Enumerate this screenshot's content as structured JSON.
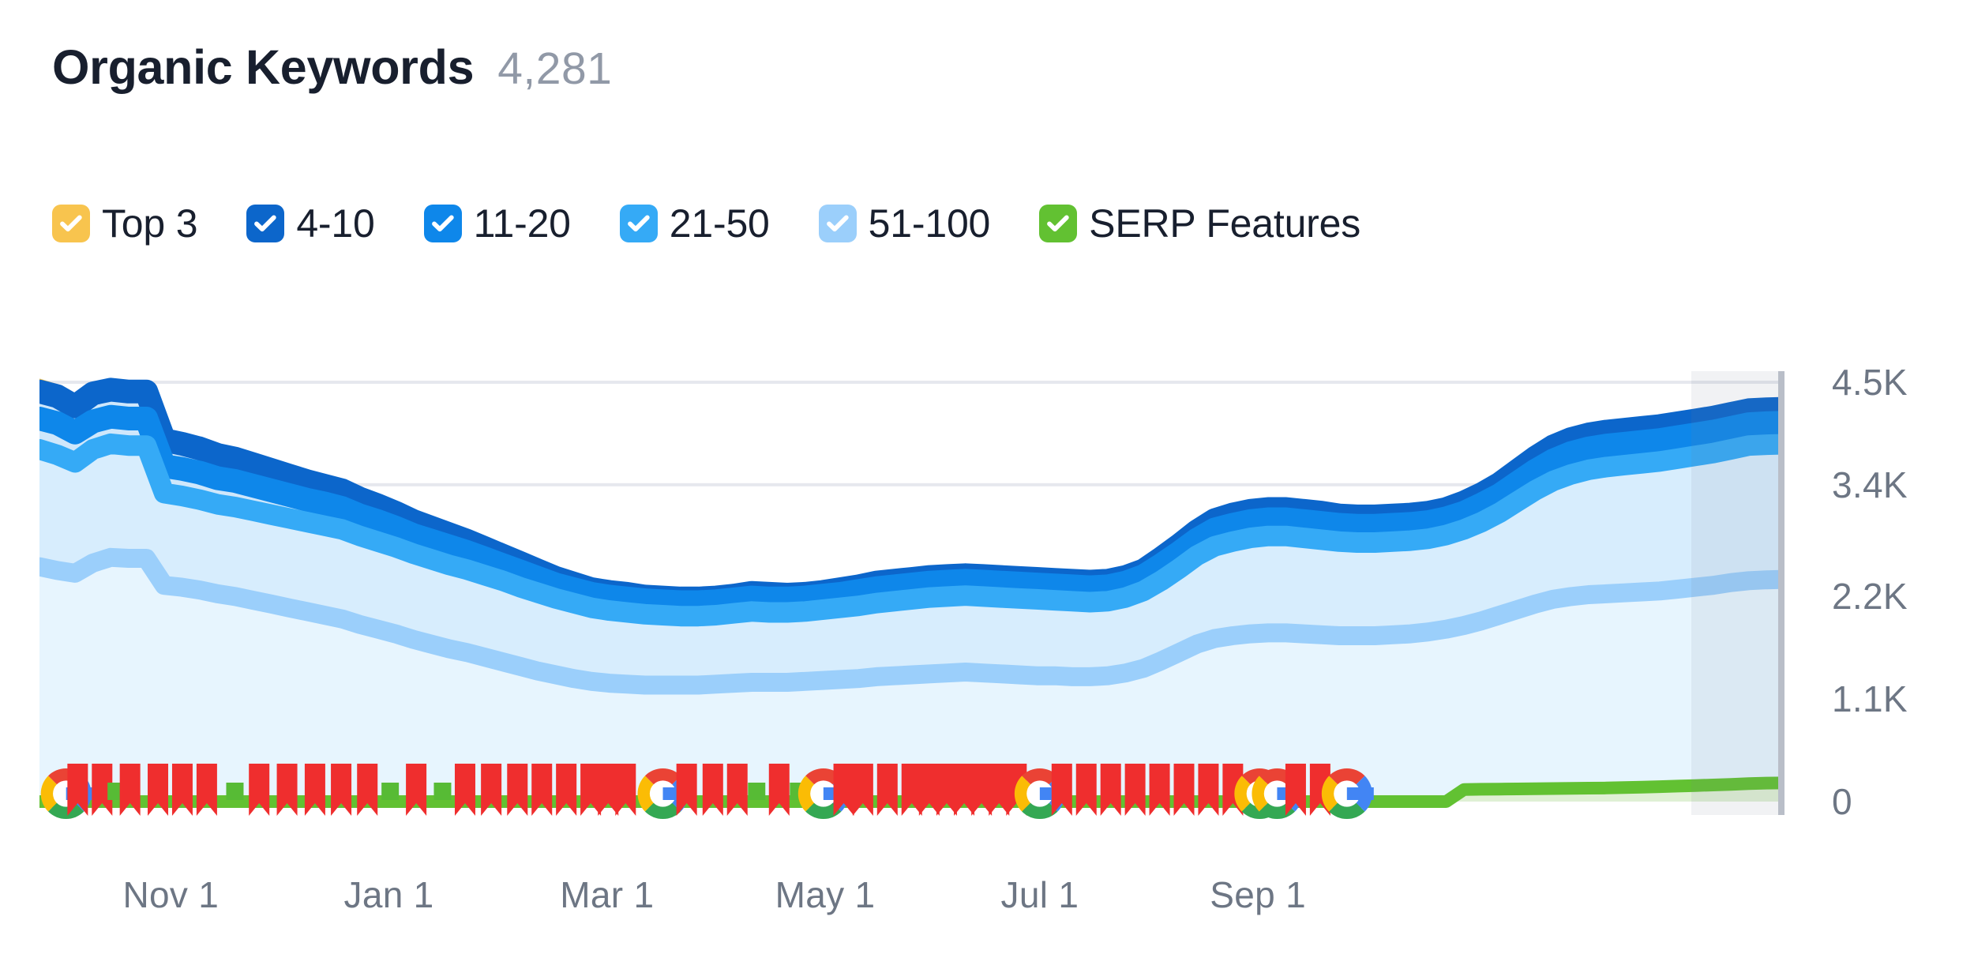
{
  "header": {
    "title": "Organic Keywords",
    "value": "4,281"
  },
  "legend": {
    "items": [
      {
        "label": "Top 3",
        "color": "#f8c44e",
        "checked": true,
        "icon": "check-icon"
      },
      {
        "label": "4-10",
        "color": "#0c66cb",
        "checked": true,
        "icon": "check-icon"
      },
      {
        "label": "11-20",
        "color": "#0e87ea",
        "checked": true,
        "icon": "check-icon"
      },
      {
        "label": "21-50",
        "color": "#35aaf6",
        "checked": true,
        "icon": "check-icon"
      },
      {
        "label": "51-100",
        "color": "#9bcffb",
        "checked": true,
        "icon": "check-icon"
      },
      {
        "label": "SERP Features",
        "color": "#62c132",
        "checked": true,
        "icon": "check-icon"
      }
    ]
  },
  "chart_data": {
    "type": "area",
    "title": "Organic Keywords",
    "xlabel": "",
    "ylabel": "",
    "stacked": true,
    "grid": true,
    "legend_position": "top",
    "ylim": [
      0,
      4500
    ],
    "yticks": [
      0,
      1100,
      2200,
      3400,
      4500
    ],
    "ytick_labels": [
      "0",
      "1.1K",
      "2.2K",
      "3.4K",
      "4.5K"
    ],
    "xticks": [
      "Nov 1",
      "Jan 1",
      "Mar 1",
      "May 1",
      "Jul 1",
      "Sep 1"
    ],
    "xtick_positions_pct": [
      3.0,
      15.5,
      28.0,
      40.5,
      52.8,
      65.3
    ],
    "x_start": "Oct 15",
    "x_end": "Sep 30",
    "colors": {
      "top3": "#f8c44e",
      "r4_10": "#0c66cb",
      "r11_20": "#0e87ea",
      "r21_50": "#35aaf6",
      "r51_100": "#9bcffb",
      "serp": "#62c132",
      "fill_light": "#ddeffc",
      "fill_lighter": "#e7f4fd",
      "grid": "#e6e8ee"
    },
    "series": [
      {
        "name": "Top 3",
        "values": [
          4500,
          4440,
          4320,
          4460,
          4500,
          4480,
          4480,
          3960,
          3920,
          3870,
          3800,
          3760,
          3700,
          3640,
          3580,
          3520,
          3470,
          3420,
          3330,
          3250,
          3170,
          3080,
          3010,
          2940,
          2870,
          2790,
          2700,
          2620,
          2540,
          2460,
          2390,
          2330,
          2300,
          2280,
          2250,
          2240,
          2230,
          2230,
          2240,
          2260,
          2290,
          2280,
          2270,
          2280,
          2300,
          2330,
          2360,
          2400,
          2420,
          2440,
          2460,
          2470,
          2480,
          2470,
          2460,
          2450,
          2440,
          2430,
          2420,
          2410,
          2420,
          2460,
          2530,
          2660,
          2800,
          2960,
          3080,
          3140,
          3180,
          3200,
          3200,
          3180,
          3160,
          3130,
          3120,
          3120,
          3130,
          3140,
          3160,
          3200,
          3270,
          3360,
          3480,
          3620,
          3760,
          3880,
          3960,
          4010,
          4040,
          4060,
          4080,
          4100,
          4130,
          4160,
          4190,
          4230,
          4270,
          4280,
          4281
        ]
      },
      {
        "name": "4-10",
        "values": [
          4400,
          4350,
          4240,
          4380,
          4420,
          4400,
          4400,
          3880,
          3840,
          3790,
          3720,
          3680,
          3620,
          3560,
          3500,
          3440,
          3390,
          3340,
          3250,
          3180,
          3100,
          3010,
          2940,
          2870,
          2800,
          2720,
          2640,
          2560,
          2480,
          2400,
          2340,
          2280,
          2250,
          2230,
          2200,
          2190,
          2180,
          2180,
          2190,
          2210,
          2240,
          2230,
          2220,
          2230,
          2250,
          2280,
          2310,
          2350,
          2370,
          2390,
          2410,
          2420,
          2430,
          2420,
          2410,
          2400,
          2390,
          2380,
          2370,
          2360,
          2370,
          2410,
          2480,
          2610,
          2750,
          2900,
          3020,
          3080,
          3120,
          3140,
          3140,
          3120,
          3100,
          3070,
          3060,
          3060,
          3070,
          3080,
          3100,
          3140,
          3210,
          3300,
          3410,
          3550,
          3690,
          3810,
          3890,
          3940,
          3970,
          3990,
          4010,
          4030,
          4060,
          4090,
          4120,
          4160,
          4200,
          4210,
          4215
        ]
      },
      {
        "name": "11-20",
        "values": [
          4110,
          4060,
          3960,
          4080,
          4130,
          4110,
          4110,
          3600,
          3570,
          3530,
          3470,
          3440,
          3390,
          3340,
          3290,
          3240,
          3200,
          3150,
          3070,
          3010,
          2940,
          2860,
          2800,
          2740,
          2680,
          2610,
          2540,
          2470,
          2400,
          2330,
          2280,
          2230,
          2200,
          2180,
          2160,
          2150,
          2140,
          2140,
          2150,
          2170,
          2190,
          2180,
          2180,
          2190,
          2210,
          2230,
          2260,
          2290,
          2310,
          2330,
          2350,
          2360,
          2370,
          2360,
          2350,
          2340,
          2330,
          2320,
          2310,
          2300,
          2310,
          2350,
          2420,
          2540,
          2670,
          2810,
          2920,
          2970,
          3010,
          3030,
          3030,
          3010,
          2990,
          2970,
          2960,
          2960,
          2970,
          2980,
          3000,
          3040,
          3100,
          3190,
          3290,
          3420,
          3550,
          3660,
          3740,
          3790,
          3820,
          3840,
          3860,
          3880,
          3910,
          3940,
          3970,
          4010,
          4050,
          4060,
          4065
        ]
      },
      {
        "name": "21-50",
        "values": [
          3780,
          3720,
          3640,
          3780,
          3840,
          3820,
          3820,
          3310,
          3280,
          3240,
          3190,
          3160,
          3120,
          3080,
          3040,
          3000,
          2960,
          2920,
          2850,
          2790,
          2730,
          2660,
          2600,
          2540,
          2490,
          2430,
          2370,
          2300,
          2240,
          2180,
          2130,
          2080,
          2050,
          2030,
          2010,
          2000,
          1990,
          1990,
          2000,
          2020,
          2040,
          2030,
          2030,
          2040,
          2060,
          2080,
          2100,
          2130,
          2150,
          2170,
          2190,
          2200,
          2210,
          2200,
          2190,
          2180,
          2170,
          2160,
          2150,
          2140,
          2150,
          2190,
          2260,
          2370,
          2500,
          2640,
          2740,
          2790,
          2830,
          2850,
          2850,
          2830,
          2810,
          2790,
          2780,
          2780,
          2790,
          2800,
          2820,
          2860,
          2920,
          3000,
          3100,
          3220,
          3340,
          3440,
          3510,
          3560,
          3590,
          3610,
          3630,
          3650,
          3680,
          3710,
          3740,
          3780,
          3820,
          3830,
          3835
        ]
      },
      {
        "name": "51-100",
        "values": [
          2520,
          2480,
          2450,
          2560,
          2620,
          2610,
          2610,
          2320,
          2300,
          2270,
          2230,
          2200,
          2160,
          2120,
          2080,
          2040,
          2000,
          1960,
          1900,
          1850,
          1800,
          1740,
          1690,
          1640,
          1600,
          1550,
          1500,
          1450,
          1400,
          1360,
          1320,
          1290,
          1270,
          1260,
          1250,
          1250,
          1250,
          1250,
          1260,
          1270,
          1280,
          1280,
          1280,
          1290,
          1300,
          1310,
          1320,
          1340,
          1350,
          1360,
          1370,
          1380,
          1390,
          1380,
          1370,
          1360,
          1350,
          1350,
          1340,
          1340,
          1350,
          1380,
          1430,
          1510,
          1600,
          1690,
          1750,
          1780,
          1800,
          1810,
          1810,
          1800,
          1790,
          1780,
          1780,
          1780,
          1790,
          1800,
          1820,
          1850,
          1890,
          1940,
          2000,
          2060,
          2120,
          2170,
          2200,
          2220,
          2230,
          2240,
          2250,
          2260,
          2280,
          2300,
          2320,
          2350,
          2370,
          2380,
          2385
        ]
      },
      {
        "name": "SERP Features",
        "values": [
          0,
          0,
          0,
          0,
          0,
          0,
          0,
          0,
          0,
          0,
          0,
          0,
          0,
          0,
          0,
          0,
          0,
          0,
          0,
          0,
          0,
          0,
          0,
          0,
          0,
          0,
          0,
          0,
          0,
          0,
          0,
          0,
          0,
          0,
          0,
          0,
          0,
          0,
          0,
          0,
          0,
          0,
          0,
          0,
          0,
          0,
          0,
          0,
          0,
          0,
          0,
          0,
          0,
          0,
          0,
          0,
          0,
          0,
          0,
          0,
          0,
          0,
          0,
          0,
          0,
          0,
          0,
          0,
          0,
          0,
          0,
          0,
          0,
          0,
          0,
          0,
          0,
          0,
          0,
          0,
          130,
          132,
          134,
          136,
          138,
          140,
          142,
          144,
          146,
          150,
          155,
          160,
          166,
          172,
          178,
          185,
          192,
          198,
          200
        ]
      }
    ],
    "annotations": {
      "description": "Google algorithm update markers row along the baseline",
      "marker_types": [
        "red-flag",
        "green-bar",
        "google-g"
      ],
      "markers": [
        {
          "type": "google-g",
          "pos": 0.8
        },
        {
          "type": "red-flag",
          "pos": 1.6
        },
        {
          "type": "red-flag",
          "pos": 3.0
        },
        {
          "type": "green-bar",
          "pos": 3.9
        },
        {
          "type": "red-flag",
          "pos": 4.6
        },
        {
          "type": "red-flag",
          "pos": 6.2
        },
        {
          "type": "red-flag",
          "pos": 7.6
        },
        {
          "type": "red-flag",
          "pos": 9.0
        },
        {
          "type": "green-bar",
          "pos": 10.7
        },
        {
          "type": "red-flag",
          "pos": 12.0
        },
        {
          "type": "red-flag",
          "pos": 13.6
        },
        {
          "type": "red-flag",
          "pos": 15.2
        },
        {
          "type": "red-flag",
          "pos": 16.7
        },
        {
          "type": "red-flag",
          "pos": 18.2
        },
        {
          "type": "green-bar",
          "pos": 19.6
        },
        {
          "type": "red-flag",
          "pos": 21.0
        },
        {
          "type": "green-bar",
          "pos": 22.6
        },
        {
          "type": "red-flag",
          "pos": 23.8
        },
        {
          "type": "red-flag",
          "pos": 25.3
        },
        {
          "type": "red-flag",
          "pos": 26.8
        },
        {
          "type": "red-flag",
          "pos": 28.2
        },
        {
          "type": "red-flag",
          "pos": 29.6
        },
        {
          "type": "red-flag",
          "pos": 31.0
        },
        {
          "type": "red-flag",
          "pos": 32.0
        },
        {
          "type": "red-flag",
          "pos": 33.0
        },
        {
          "type": "google-g",
          "pos": 35.0
        },
        {
          "type": "red-flag",
          "pos": 36.5
        },
        {
          "type": "red-flag",
          "pos": 38.0
        },
        {
          "type": "red-flag",
          "pos": 39.4
        },
        {
          "type": "green-bar",
          "pos": 40.6
        },
        {
          "type": "red-flag",
          "pos": 41.8
        },
        {
          "type": "green-bar",
          "pos": 43.0
        },
        {
          "type": "google-g",
          "pos": 44.2
        },
        {
          "type": "red-flag",
          "pos": 45.5
        },
        {
          "type": "red-flag",
          "pos": 46.6
        },
        {
          "type": "red-flag",
          "pos": 48.0
        },
        {
          "type": "red-flag",
          "pos": 49.4
        },
        {
          "type": "red-flag",
          "pos": 50.4
        },
        {
          "type": "red-flag",
          "pos": 51.4
        },
        {
          "type": "red-flag",
          "pos": 52.4
        },
        {
          "type": "red-flag",
          "pos": 53.4
        },
        {
          "type": "red-flag",
          "pos": 54.4
        },
        {
          "type": "red-flag",
          "pos": 55.4
        },
        {
          "type": "google-g",
          "pos": 56.6
        },
        {
          "type": "red-flag",
          "pos": 58.0
        },
        {
          "type": "red-flag",
          "pos": 59.4
        },
        {
          "type": "red-flag",
          "pos": 60.8
        },
        {
          "type": "red-flag",
          "pos": 62.2
        },
        {
          "type": "red-flag",
          "pos": 63.6
        },
        {
          "type": "red-flag",
          "pos": 65.0
        },
        {
          "type": "red-flag",
          "pos": 66.4
        },
        {
          "type": "red-flag",
          "pos": 67.8
        },
        {
          "type": "google-g",
          "pos": 69.2
        },
        {
          "type": "google-g",
          "pos": 70.2
        },
        {
          "type": "red-flag",
          "pos": 71.4
        },
        {
          "type": "red-flag",
          "pos": 72.8
        },
        {
          "type": "google-g",
          "pos": 74.2
        }
      ]
    }
  }
}
